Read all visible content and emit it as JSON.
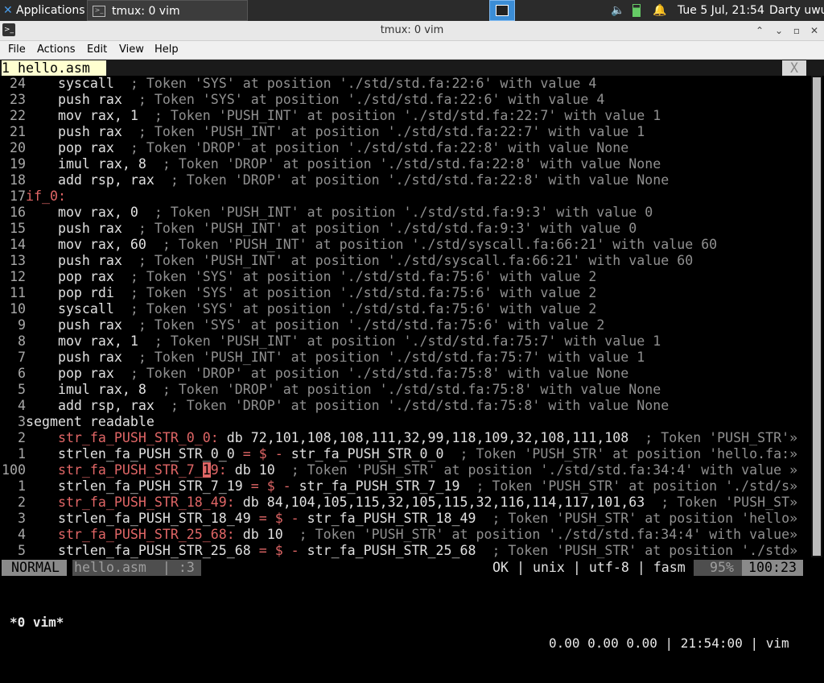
{
  "panel": {
    "apps_label": "Applications",
    "task_label": "tmux: 0 vim",
    "clock": "Tue  5 Jul, 21:54",
    "user": "Darty uwu",
    "icons": [
      "xfce-logo-icon",
      "terminal-icon",
      "workspace-icon",
      "volume-icon",
      "battery-icon",
      "bell-icon"
    ]
  },
  "window": {
    "title": "tmux: 0 vim",
    "menu": [
      "File",
      "Actions",
      "Edit",
      "View",
      "Help"
    ]
  },
  "vim": {
    "tab_label": "1 hello.asm",
    "tab_close": "X",
    "lines": [
      {
        "n": "24",
        "segs": [
          [
            "    ",
            "pl"
          ],
          [
            "syscall",
            "kw"
          ],
          [
            "  ; Token 'SYS' at position './std/std.fa:22:6' with value 4",
            "cmt"
          ]
        ]
      },
      {
        "n": "23",
        "segs": [
          [
            "    ",
            "pl"
          ],
          [
            "push rax",
            "kw"
          ],
          [
            "  ; Token 'SYS' at position './std/std.fa:22:6' with value 4",
            "cmt"
          ]
        ]
      },
      {
        "n": "22",
        "segs": [
          [
            "    ",
            "pl"
          ],
          [
            "mov rax, 1",
            "kw"
          ],
          [
            "  ; Token 'PUSH_INT' at position './std/std.fa:22:7' with value 1",
            "cmt"
          ]
        ]
      },
      {
        "n": "21",
        "segs": [
          [
            "    ",
            "pl"
          ],
          [
            "push rax",
            "kw"
          ],
          [
            "  ; Token 'PUSH_INT' at position './std/std.fa:22:7' with value 1",
            "cmt"
          ]
        ]
      },
      {
        "n": "20",
        "segs": [
          [
            "    ",
            "pl"
          ],
          [
            "pop rax",
            "kw"
          ],
          [
            "  ; Token 'DROP' at position './std/std.fa:22:8' with value None",
            "cmt"
          ]
        ]
      },
      {
        "n": "19",
        "segs": [
          [
            "    ",
            "pl"
          ],
          [
            "imul rax, 8",
            "kw"
          ],
          [
            "  ; Token 'DROP' at position './std/std.fa:22:8' with value None",
            "cmt"
          ]
        ]
      },
      {
        "n": "18",
        "segs": [
          [
            "    ",
            "pl"
          ],
          [
            "add rsp, rax",
            "kw"
          ],
          [
            "  ; Token 'DROP' at position './std/std.fa:22:8' with value None",
            "cmt"
          ]
        ]
      },
      {
        "n": "17",
        "segs": [
          [
            "if_0:",
            "lbl"
          ]
        ]
      },
      {
        "n": "16",
        "segs": [
          [
            "    ",
            "pl"
          ],
          [
            "mov rax, 0",
            "kw"
          ],
          [
            "  ; Token 'PUSH_INT' at position './std/std.fa:9:3' with value 0",
            "cmt"
          ]
        ]
      },
      {
        "n": "15",
        "segs": [
          [
            "    ",
            "pl"
          ],
          [
            "push rax",
            "kw"
          ],
          [
            "  ; Token 'PUSH_INT' at position './std/std.fa:9:3' with value 0",
            "cmt"
          ]
        ]
      },
      {
        "n": "14",
        "segs": [
          [
            "    ",
            "pl"
          ],
          [
            "mov rax, 60",
            "kw"
          ],
          [
            "  ; Token 'PUSH_INT' at position './std/syscall.fa:66:21' with value 60",
            "cmt"
          ]
        ]
      },
      {
        "n": "13",
        "segs": [
          [
            "    ",
            "pl"
          ],
          [
            "push rax",
            "kw"
          ],
          [
            "  ; Token 'PUSH_INT' at position './std/syscall.fa:66:21' with value 60",
            "cmt"
          ]
        ]
      },
      {
        "n": "12",
        "segs": [
          [
            "    ",
            "pl"
          ],
          [
            "pop rax",
            "kw"
          ],
          [
            "  ; Token 'SYS' at position './std/std.fa:75:6' with value 2",
            "cmt"
          ]
        ]
      },
      {
        "n": "11",
        "segs": [
          [
            "    ",
            "pl"
          ],
          [
            "pop rdi",
            "kw"
          ],
          [
            "  ; Token 'SYS' at position './std/std.fa:75:6' with value 2",
            "cmt"
          ]
        ]
      },
      {
        "n": "10",
        "segs": [
          [
            "    ",
            "pl"
          ],
          [
            "syscall",
            "kw"
          ],
          [
            "  ; Token 'SYS' at position './std/std.fa:75:6' with value 2",
            "cmt"
          ]
        ]
      },
      {
        "n": "9",
        "segs": [
          [
            "    ",
            "pl"
          ],
          [
            "push rax",
            "kw"
          ],
          [
            "  ; Token 'SYS' at position './std/std.fa:75:6' with value 2",
            "cmt"
          ]
        ]
      },
      {
        "n": "8",
        "segs": [
          [
            "    ",
            "pl"
          ],
          [
            "mov rax, 1",
            "kw"
          ],
          [
            "  ; Token 'PUSH_INT' at position './std/std.fa:75:7' with value 1",
            "cmt"
          ]
        ]
      },
      {
        "n": "7",
        "segs": [
          [
            "    ",
            "pl"
          ],
          [
            "push rax",
            "kw"
          ],
          [
            "  ; Token 'PUSH_INT' at position './std/std.fa:75:7' with value 1",
            "cmt"
          ]
        ]
      },
      {
        "n": "6",
        "segs": [
          [
            "    ",
            "pl"
          ],
          [
            "pop rax",
            "kw"
          ],
          [
            "  ; Token 'DROP' at position './std/std.fa:75:8' with value None",
            "cmt"
          ]
        ]
      },
      {
        "n": "5",
        "segs": [
          [
            "    ",
            "pl"
          ],
          [
            "imul rax, 8",
            "kw"
          ],
          [
            "  ; Token 'DROP' at position './std/std.fa:75:8' with value None",
            "cmt"
          ]
        ]
      },
      {
        "n": "4",
        "segs": [
          [
            "    ",
            "pl"
          ],
          [
            "add rsp, rax",
            "kw"
          ],
          [
            "  ; Token 'DROP' at position './std/std.fa:75:8' with value None",
            "cmt"
          ]
        ]
      },
      {
        "n": "3",
        "segs": [
          [
            "segment readable",
            "kw"
          ]
        ]
      },
      {
        "n": "2",
        "segs": [
          [
            "    ",
            "pl"
          ],
          [
            "str_fa_PUSH_STR_0_0:",
            "lbl"
          ],
          [
            " db 72,101,108,108,111,32,99,118,109,32,108,111,108",
            "pl"
          ],
          [
            "  ; Token 'PUSH_STR'»",
            "cmt"
          ]
        ]
      },
      {
        "n": "1",
        "segs": [
          [
            "    ",
            "pl"
          ],
          [
            "strlen_fa_PUSH_STR_0_0",
            "pl"
          ],
          [
            " = $ - ",
            "lbl"
          ],
          [
            "str_fa_PUSH_STR_0_0",
            "pl"
          ],
          [
            "  ; Token 'PUSH_STR' at position 'hello.fa:»",
            "cmt"
          ]
        ]
      },
      {
        "n": "100",
        "segs": [
          [
            "    ",
            "pl"
          ],
          [
            "str_fa_PUSH_STR_7_",
            "lbl"
          ],
          [
            "1",
            "cur"
          ],
          [
            "9:",
            "lbl"
          ],
          [
            " db 10",
            "pl"
          ],
          [
            "  ; Token 'PUSH_STR' at position './std/std.fa:34:4' with value »",
            "cmt"
          ]
        ]
      },
      {
        "n": "1",
        "segs": [
          [
            "    ",
            "pl"
          ],
          [
            "strlen_fa_PUSH_STR_7_19",
            "pl"
          ],
          [
            " = $ - ",
            "lbl"
          ],
          [
            "str_fa_PUSH_STR_7_19",
            "pl"
          ],
          [
            "  ; Token 'PUSH_STR' at position './std/s»",
            "cmt"
          ]
        ]
      },
      {
        "n": "2",
        "segs": [
          [
            "    ",
            "pl"
          ],
          [
            "str_fa_PUSH_STR_18_49:",
            "lbl"
          ],
          [
            " db 84,104,105,115,32,105,115,32,116,114,117,101,63",
            "pl"
          ],
          [
            "  ; Token 'PUSH_ST»",
            "cmt"
          ]
        ]
      },
      {
        "n": "3",
        "segs": [
          [
            "    ",
            "pl"
          ],
          [
            "strlen_fa_PUSH_STR_18_49",
            "pl"
          ],
          [
            " = $ - ",
            "lbl"
          ],
          [
            "str_fa_PUSH_STR_18_49",
            "pl"
          ],
          [
            "  ; Token 'PUSH_STR' at position 'hello»",
            "cmt"
          ]
        ]
      },
      {
        "n": "4",
        "segs": [
          [
            "    ",
            "pl"
          ],
          [
            "str_fa_PUSH_STR_25_68:",
            "lbl"
          ],
          [
            " db 10",
            "pl"
          ],
          [
            "  ; Token 'PUSH_STR' at position './std/std.fa:34:4' with value»",
            "cmt"
          ]
        ]
      },
      {
        "n": "5",
        "segs": [
          [
            "    ",
            "pl"
          ],
          [
            "strlen_fa_PUSH_STR_25_68",
            "pl"
          ],
          [
            " = $ - ",
            "lbl"
          ],
          [
            "str_fa_PUSH_STR_25_68",
            "pl"
          ],
          [
            "  ; Token 'PUSH_STR' at position './std»",
            "cmt"
          ]
        ]
      }
    ],
    "status": {
      "mode": "NORMAL",
      "file": "hello.asm  | :3",
      "right": "OK | unix | utf-8 | fasm",
      "percent": "95%",
      "position": "100:23"
    }
  },
  "tmux": {
    "left": "*0 vim*",
    "right": "0.00 0.00 0.00 | 21:54:00 | vim"
  },
  "colors": {
    "label": "#e06666",
    "comment": "#909090",
    "tab_bg": "#ffffd0",
    "workspace_active": "#3b8dd6"
  }
}
